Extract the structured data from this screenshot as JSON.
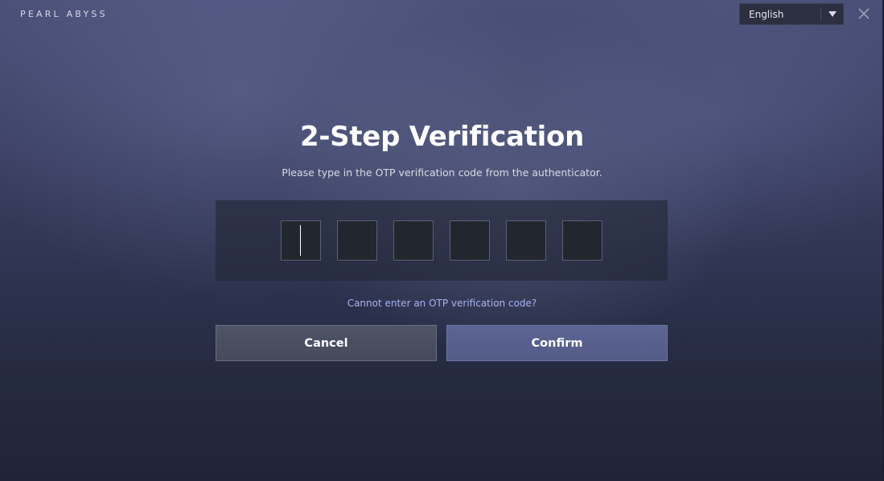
{
  "header": {
    "brand": "PEARL ABYSS",
    "language": {
      "selected": "English",
      "caret_icon": "caret-down-icon"
    },
    "close_icon": "close-icon"
  },
  "dialog": {
    "title": "2-Step Verification",
    "subtitle": "Please type in the OTP verification code from the authenticator.",
    "otp_digits": [
      "",
      "",
      "",
      "",
      "",
      ""
    ],
    "help_link": "Cannot enter an OTP verification code?",
    "cancel_label": "Cancel",
    "confirm_label": "Confirm"
  },
  "colors": {
    "link": "#a9b4f2",
    "confirm": "#58608d",
    "cancel": "#4b4f62"
  }
}
